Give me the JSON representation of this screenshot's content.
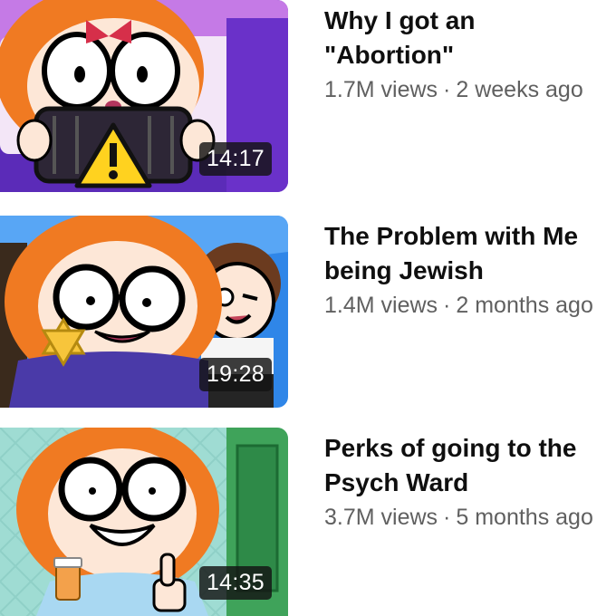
{
  "videos": [
    {
      "title_lines": [
        "Why I got an",
        "\"Abortion\""
      ],
      "views": "1.7M views",
      "age": "2 weeks ago",
      "duration": "14:17",
      "thumbnail_icon": "warning-icon",
      "accent": "#7b3fd0"
    },
    {
      "title_lines": [
        "The Problem with Me",
        "being Jewish"
      ],
      "views": "1.4M views",
      "age": "2 months ago",
      "duration": "19:28",
      "thumbnail_icon": "star-of-david-icon",
      "accent": "#2f86e8"
    },
    {
      "title_lines": [
        "Perks of going to the",
        "Psych Ward"
      ],
      "views": "3.7M views",
      "age": "5 months ago",
      "duration": "14:35",
      "thumbnail_icon": "thumbs-up-icon",
      "accent": "#7fd3c9"
    }
  ],
  "separator": "·"
}
